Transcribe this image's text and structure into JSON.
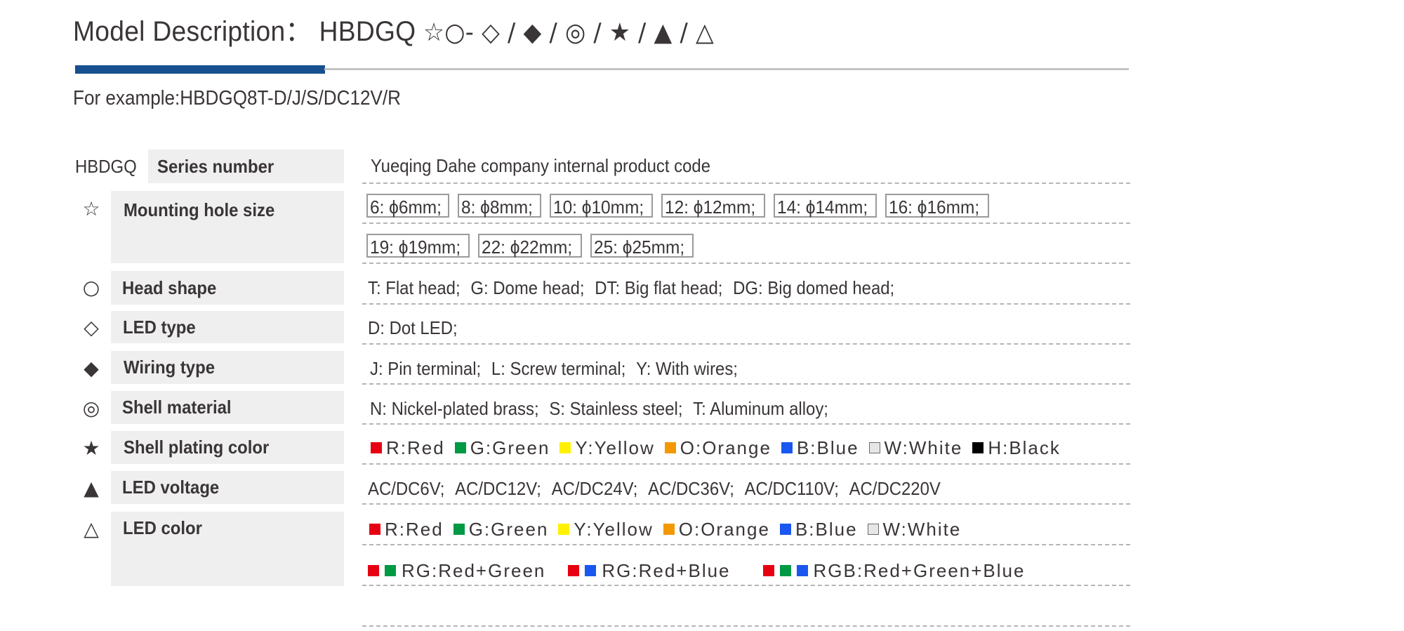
{
  "header": {
    "title_prefix": "Model Description：",
    "model_code": "HBDGQ",
    "pattern_symbols": "☆○- ◇ / ◆ / ◎ / ★ / ▲ / △",
    "example": "For example:HBDGQ8T-D/J/S/DC12V/R",
    "accent_color": "#17508f"
  },
  "table": {
    "series_prefix": "HBDGQ",
    "rows": [
      {
        "icon": "none",
        "label": "Series number",
        "value": "Yueqing Dahe company internal product code"
      },
      {
        "icon": "white-star-icon",
        "symbol": "☆",
        "label": "Mounting hole size",
        "options_line1": [
          "6: ϕ6mm;",
          "8: ϕ8mm;",
          "10: ϕ10mm;",
          "12: ϕ12mm;",
          "14: ϕ14mm;",
          "16: ϕ16mm;"
        ],
        "options_line2": [
          "19: ϕ19mm;",
          "22: ϕ22mm;",
          "25: ϕ25mm;"
        ]
      },
      {
        "icon": "white-circle-icon",
        "symbol": "○",
        "label": "Head  shape",
        "options": [
          "T: Flat head;",
          "G: Dome head;",
          "DT: Big flat head;",
          "DG: Big domed head;"
        ]
      },
      {
        "icon": "white-diamond-icon",
        "symbol": "◇",
        "label": "LED type",
        "options": [
          "D: Dot LED;"
        ]
      },
      {
        "icon": "black-diamond-icon",
        "symbol": "◆",
        "label": "Wiring type",
        "options": [
          "J: Pin terminal;",
          "L: Screw terminal;",
          "Y: With wires;"
        ]
      },
      {
        "icon": "bullseye-icon",
        "symbol": "◎",
        "label": "Shell material",
        "options": [
          "N: Nickel-plated brass;",
          "S: Stainless steel;",
          "T: Aluminum alloy;"
        ]
      },
      {
        "icon": "black-star-icon",
        "symbol": "★",
        "label": "Shell plating color",
        "colors": [
          {
            "label": "R:Red",
            "hex": "#e60012"
          },
          {
            "label": "G:Green",
            "hex": "#009944"
          },
          {
            "label": "Y:Yellow",
            "hex": "#fff100"
          },
          {
            "label": "O:Orange",
            "hex": "#f39800"
          },
          {
            "label": "B:Blue",
            "hex": "#1a56f0"
          },
          {
            "label": "W:White",
            "hex": "#e6e6e6"
          },
          {
            "label": "H:Black",
            "hex": "#000000"
          }
        ]
      },
      {
        "icon": "black-triangle-icon",
        "symbol": "▲",
        "label": "LED voltage",
        "options": [
          "AC/DC6V;",
          "AC/DC12V;",
          "AC/DC24V;",
          "AC/DC36V;",
          "AC/DC110V;",
          "AC/DC220V"
        ]
      },
      {
        "icon": "white-triangle-icon",
        "symbol": "△",
        "label": "LED color",
        "colors": [
          {
            "label": "R:Red",
            "hex": "#e60012"
          },
          {
            "label": "G:Green",
            "hex": "#009944"
          },
          {
            "label": "Y:Yellow",
            "hex": "#fff100"
          },
          {
            "label": "O:Orange",
            "hex": "#f39800"
          },
          {
            "label": "B:Blue",
            "hex": "#1a56f0"
          },
          {
            "label": "W:White",
            "hex": "#e6e6e6"
          }
        ],
        "combos": [
          {
            "label": "RG:Red+Green",
            "hexes": [
              "#e60012",
              "#009944"
            ]
          },
          {
            "label": "RG:Red+Blue",
            "hexes": [
              "#e60012",
              "#1a56f0"
            ]
          },
          {
            "label": "RGB:Red+Green+Blue",
            "hexes": [
              "#e60012",
              "#009944",
              "#1a56f0"
            ]
          }
        ]
      }
    ]
  }
}
